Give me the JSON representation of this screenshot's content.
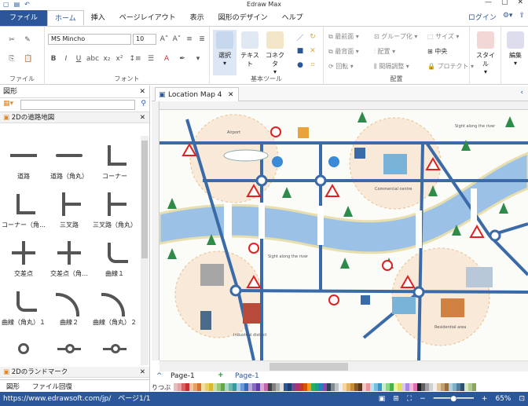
{
  "app": {
    "title": "Edraw Max"
  },
  "tabs": [
    "ファイル",
    "ホーム",
    "挿入",
    "ページレイアウト",
    "表示",
    "図形のデザイン",
    "ヘルプ"
  ],
  "account": {
    "login": "ログイン"
  },
  "ribbon": {
    "file_group": "ファイル",
    "font_group": "フォント",
    "basic_tools_group": "基本ツール",
    "arrange_group": "配置",
    "font_name": "MS Mincho",
    "font_size": "10",
    "select": "選択",
    "text": "テキスト",
    "connector": "コネクタ",
    "front": "最前面",
    "back": "最背面",
    "rotate": "回転",
    "group": "グループ化",
    "align": "配置",
    "spacing": "間隔調整",
    "size": "サイズ",
    "center": "中央",
    "protect": "プロテクト",
    "style": "スタイル",
    "edit": "編集"
  },
  "left_panel": {
    "title": "図形",
    "library1": "2Dの道路地図",
    "library2": "2Dのランドマーク",
    "shapes": [
      "道路",
      "道路（角丸）",
      "コーナー",
      "コーナー（角…",
      "三叉路",
      "三叉路（角丸）",
      "交差点",
      "交差点（角…",
      "曲線１",
      "曲線（角丸）１",
      "曲線２",
      "曲線（角丸）２"
    ],
    "tab1": "図形",
    "tab2": "ファイル回復"
  },
  "document": {
    "tab": "Location Map 4",
    "page": "Page-1",
    "page2": "Page-1",
    "fill_label": "りつぶ"
  },
  "map": {
    "airport": "Airport",
    "sight_river": "Sight along the river",
    "commercial": "Commercial centre",
    "industrial": "Industrial district",
    "residential": "Residential area",
    "sight_river2": "Sight along the river"
  },
  "status": {
    "url": "https://www.edrawsoft.com/jp/",
    "page": "ページ1/1",
    "zoom": "65%"
  }
}
